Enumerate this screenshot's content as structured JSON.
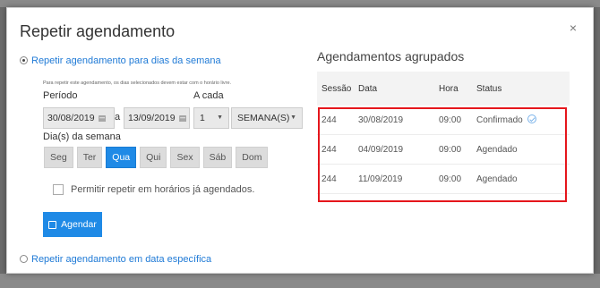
{
  "dialog": {
    "title": "Repetir agendamento",
    "close_icon": "×"
  },
  "option_weekdays": {
    "label": "Repetir agendamento para dias da semana",
    "selected": true
  },
  "hint": "Para repetir este agendamento, os dias selecionados devem estar com o horário livre.",
  "period": {
    "label": "Período",
    "start": "30/08/2019",
    "separator": "a",
    "end": "13/09/2019"
  },
  "frequency": {
    "label": "A cada",
    "count": "1",
    "unit": "SEMANA(S)"
  },
  "weekdays": {
    "label": "Dia(s) da semana",
    "items": [
      {
        "label": "Seg",
        "active": false
      },
      {
        "label": "Ter",
        "active": false
      },
      {
        "label": "Qua",
        "active": true
      },
      {
        "label": "Qui",
        "active": false
      },
      {
        "label": "Sex",
        "active": false
      },
      {
        "label": "Sáb",
        "active": false
      },
      {
        "label": "Dom",
        "active": false
      }
    ]
  },
  "allow_repeat": {
    "label": "Permitir repetir em horários já agendados.",
    "checked": false
  },
  "agendar_button": "Agendar",
  "option_specific": {
    "label": "Repetir agendamento em data específica",
    "selected": false
  },
  "grouped": {
    "title": "Agendamentos agrupados",
    "columns": [
      "Sessão",
      "Data",
      "Hora",
      "Status"
    ],
    "rows": [
      {
        "session": "244",
        "date": "30/08/2019",
        "time": "09:00",
        "status": "Confirmado",
        "confirmed": true
      },
      {
        "session": "244",
        "date": "04/09/2019",
        "time": "09:00",
        "status": "Agendado",
        "confirmed": false
      },
      {
        "session": "244",
        "date": "11/09/2019",
        "time": "09:00",
        "status": "Agendado",
        "confirmed": false
      }
    ]
  },
  "colors": {
    "accent": "#1f8ae6",
    "link": "#1f7ad6",
    "highlight_border": "#e5161c"
  }
}
